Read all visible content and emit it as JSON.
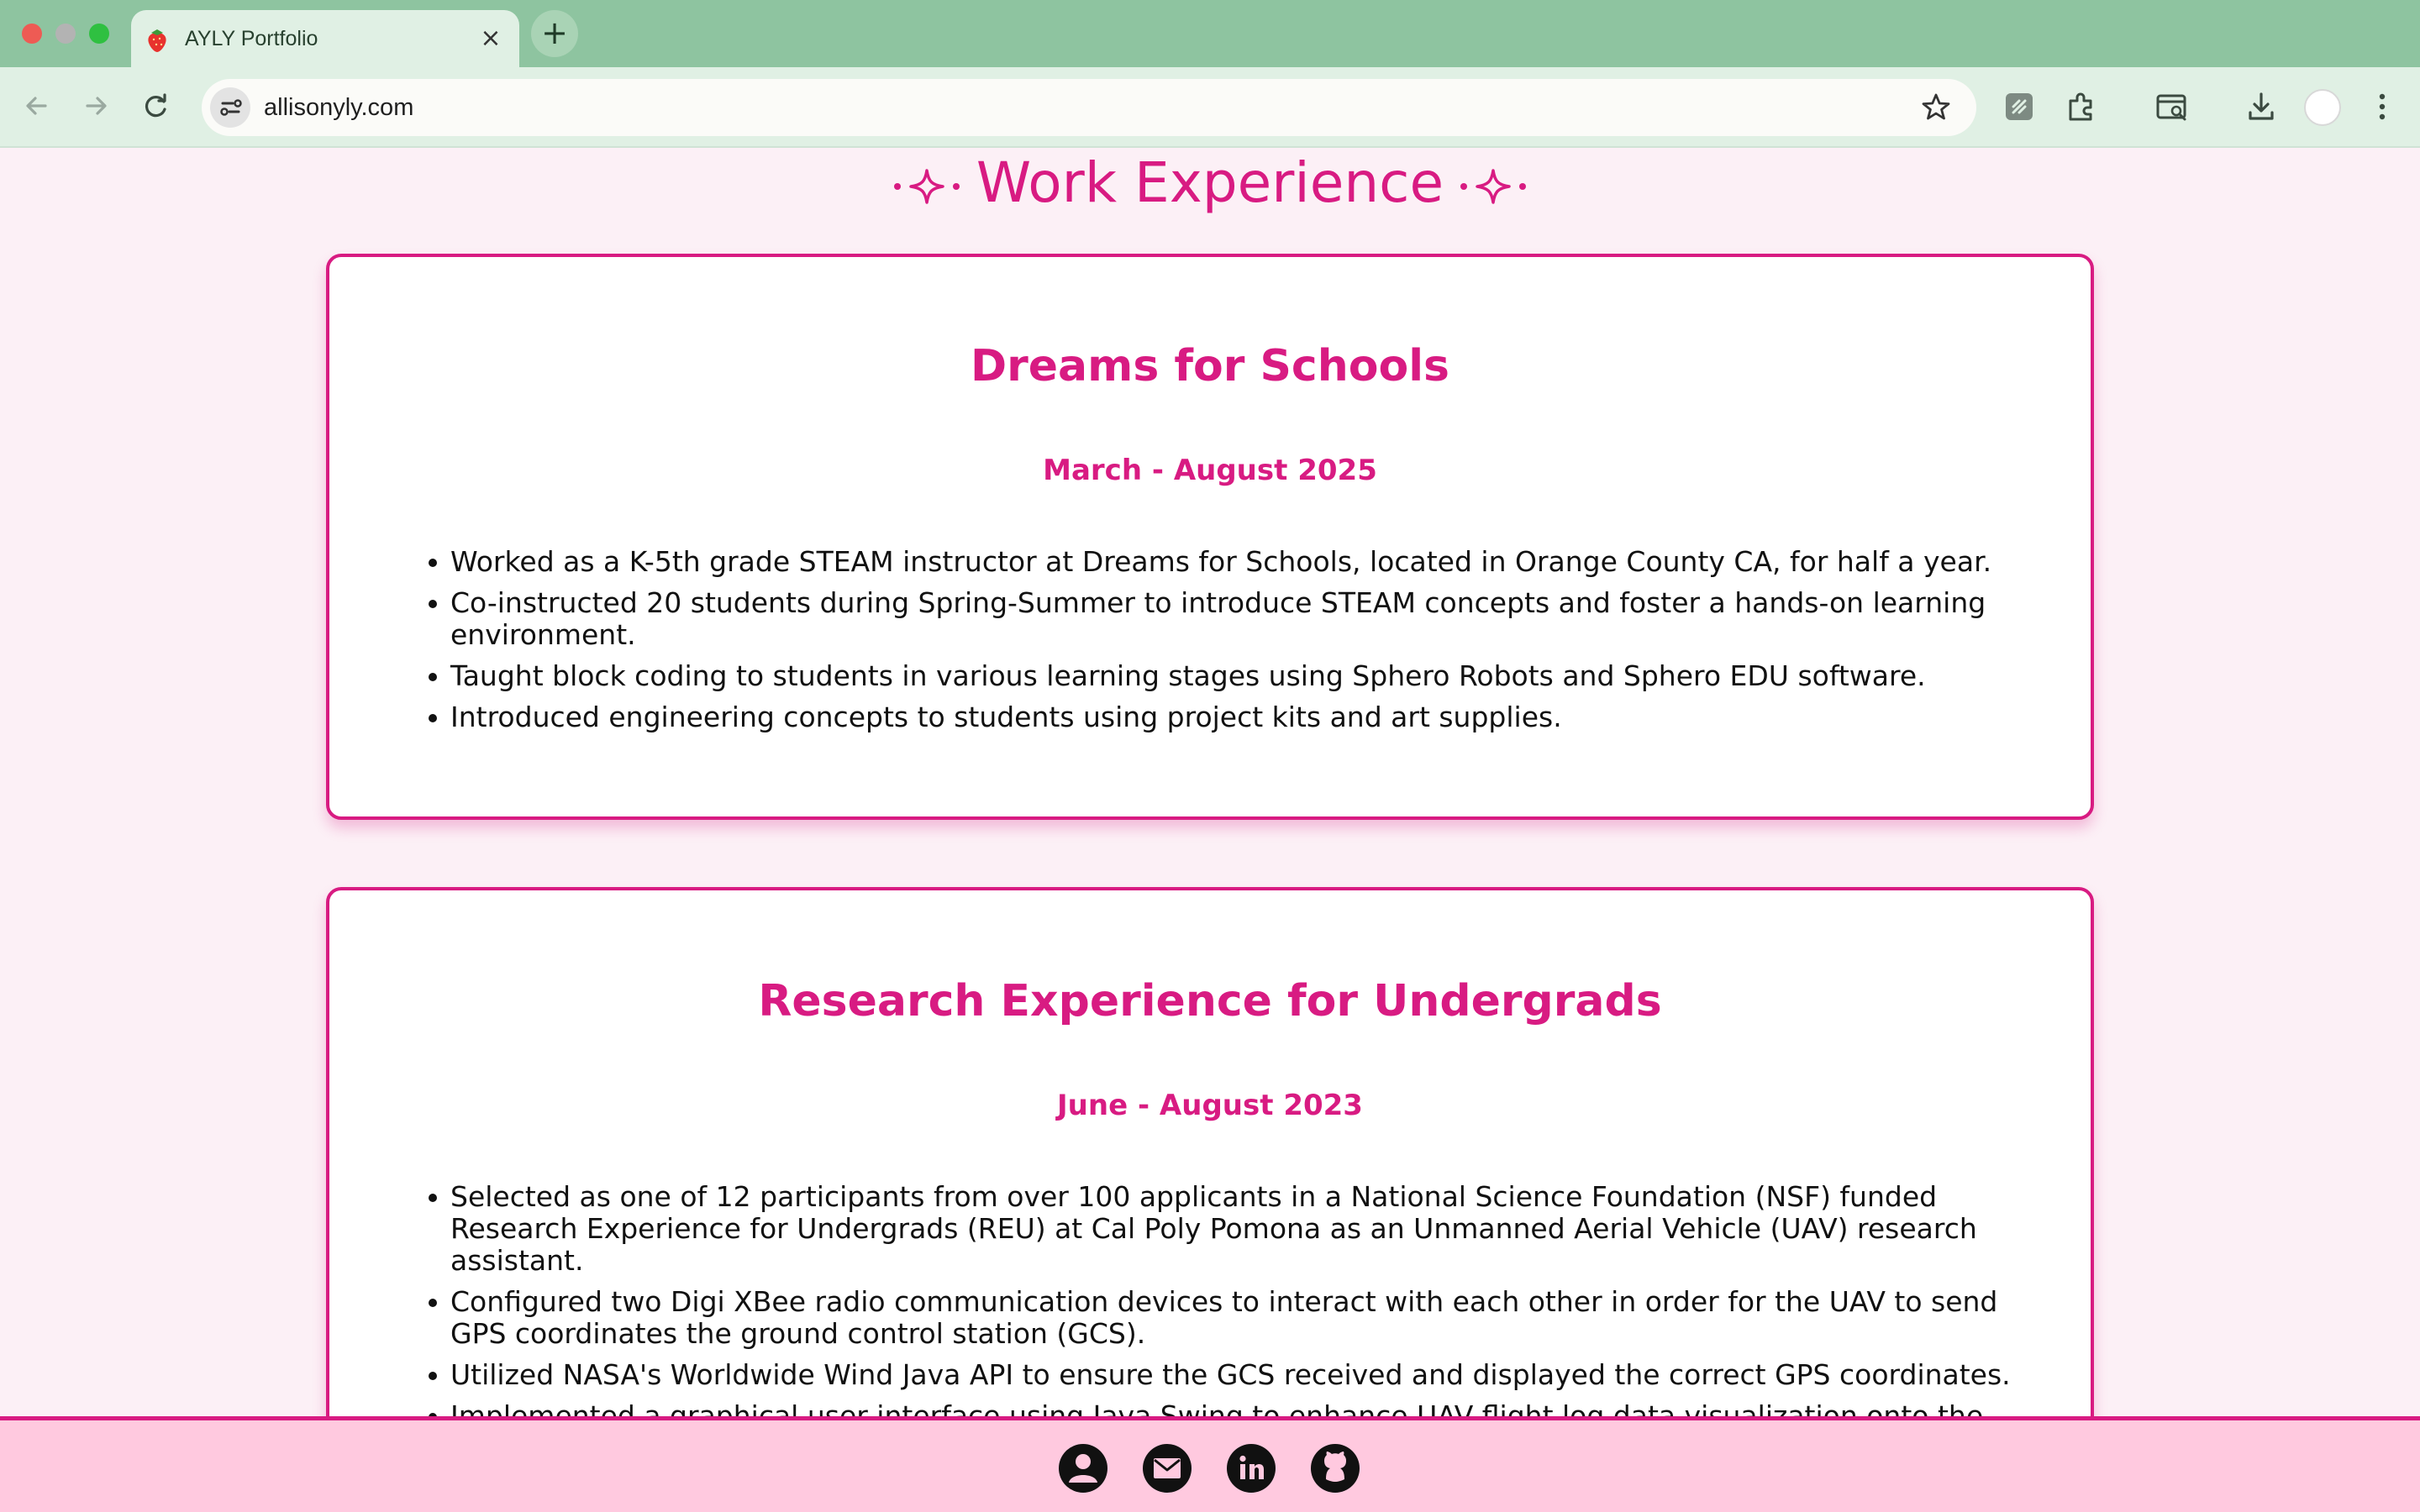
{
  "browser": {
    "tab_title": "AYLY Portfolio",
    "tab_favicon": "strawberry-icon",
    "url": "allisonyly.com",
    "colors": {
      "tabbar": "#8ec4a0",
      "toolbar": "#e0f0e4"
    }
  },
  "page": {
    "section_title": "Work Experience",
    "accent_color": "#d81b82",
    "background_color": "#fcf0f6",
    "jobs": [
      {
        "title": "Dreams for Schools",
        "date": "March - August 2025",
        "bullets": [
          "Worked as a K-5th grade STEAM instructor at Dreams for Schools, located in Orange County CA, for half a year.",
          "Co-instructed 20 students during Spring-Summer to introduce STEAM concepts and foster a hands-on learning environment.",
          "Taught block coding to students in various learning stages using Sphero Robots and Sphero EDU software.",
          "Introduced engineering concepts to students using project kits and art supplies."
        ]
      },
      {
        "title": "Research Experience for Undergrads",
        "date": "June - August 2023",
        "bullets": [
          "Selected as one of 12 participants from over 100 applicants in a National Science Foundation (NSF) funded Research Experience for Undergrads (REU) at Cal Poly Pomona as an Unmanned Aerial Vehicle (UAV) research assistant.",
          "Configured two Digi XBee radio communication devices to interact with each other in order for the UAV to send GPS coordinates the ground control station (GCS).",
          "Utilized NASA's Worldwide Wind Java API to ensure the GCS received and displayed the correct GPS coordinates.",
          "Implemented a graphical user interface using Java Swing to enhance UAV flight log data visualization onto the GCS."
        ]
      }
    ]
  },
  "footer": {
    "background_color": "#ffc9df",
    "links": [
      "profile-icon",
      "email-icon",
      "linkedin-icon",
      "github-icon"
    ]
  }
}
